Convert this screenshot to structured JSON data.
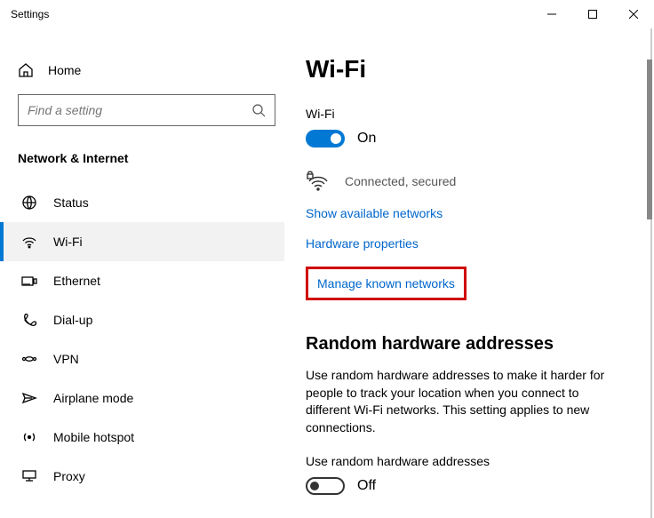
{
  "window": {
    "title": "Settings"
  },
  "sidebar": {
    "home": "Home",
    "searchPlaceholder": "Find a setting",
    "category": "Network & Internet",
    "items": [
      {
        "label": "Status",
        "selected": false
      },
      {
        "label": "Wi-Fi",
        "selected": true
      },
      {
        "label": "Ethernet",
        "selected": false
      },
      {
        "label": "Dial-up",
        "selected": false
      },
      {
        "label": "VPN",
        "selected": false
      },
      {
        "label": "Airplane mode",
        "selected": false
      },
      {
        "label": "Mobile hotspot",
        "selected": false
      },
      {
        "label": "Proxy",
        "selected": false
      }
    ]
  },
  "main": {
    "title": "Wi-Fi",
    "wifiLabel": "Wi-Fi",
    "wifiToggle": {
      "state": "on",
      "label": "On"
    },
    "connectionStatus": "Connected, secured",
    "links": {
      "showAvailable": "Show available networks",
      "hardwareProps": "Hardware properties",
      "manageKnown": "Manage known networks"
    },
    "randomSection": {
      "heading": "Random hardware addresses",
      "description": "Use random hardware addresses to make it harder for people to track your location when you connect to different Wi-Fi networks. This setting applies to new connections.",
      "toggleLabel": "Use random hardware addresses",
      "toggle": {
        "state": "off",
        "label": "Off"
      }
    }
  }
}
